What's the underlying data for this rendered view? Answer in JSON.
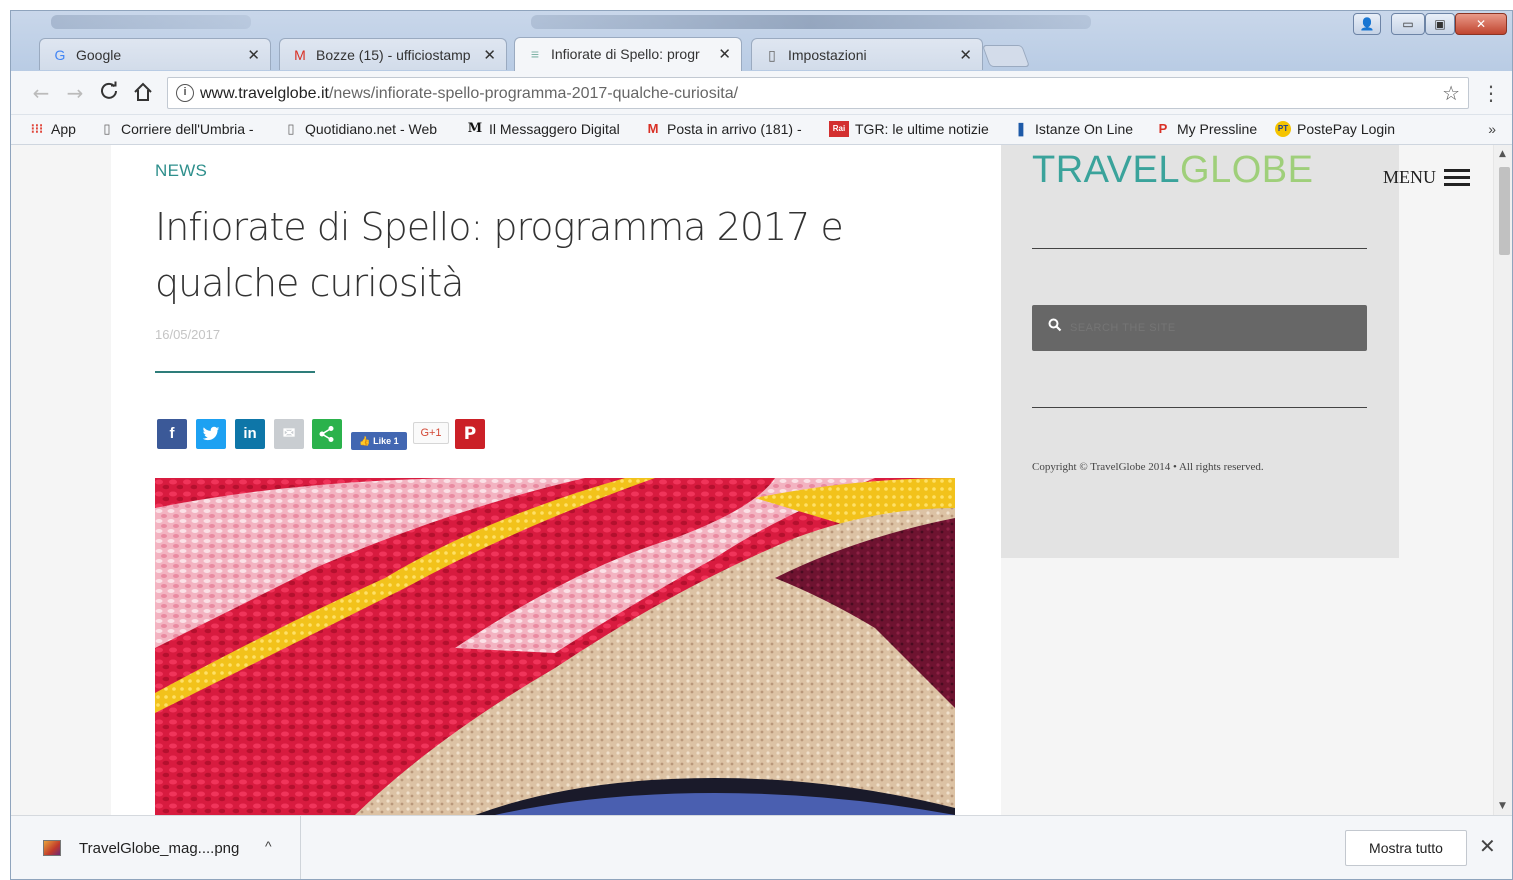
{
  "window": {
    "controls": {
      "user": "👤",
      "minimize": "▭",
      "maximize": "▣",
      "close": "✕"
    }
  },
  "tabs": [
    {
      "label": "Google",
      "icon": "G",
      "icon_name": "google-icon",
      "icon_color": "#4285f4",
      "close": "✕"
    },
    {
      "label": "Bozze (15) - ufficiostamp",
      "icon": "M",
      "icon_name": "gmail-icon",
      "icon_color": "#d93025",
      "close": "✕"
    },
    {
      "label": "Infiorate di Spello: progr",
      "icon": "≡",
      "icon_name": "page-favicon-icon",
      "icon_color": "#7fb3a6",
      "close": "✕",
      "active": true
    },
    {
      "label": "Impostazioni",
      "icon": "▯",
      "icon_name": "document-icon",
      "icon_color": "#666666",
      "close": "✕"
    }
  ],
  "toolbar": {
    "back": "←",
    "forward": "→",
    "reload": "C",
    "home": "⌂",
    "url_host": "www.travelglobe.it",
    "url_path": "/news/infiorate-spello-programma-2017-qualche-curiosita/",
    "info": "i",
    "star": "☆",
    "menu": "⋮"
  },
  "bookmarks": [
    {
      "label": "App",
      "icon": "⁝⁝⁝",
      "icon_name": "apps-grid-icon",
      "icon_color": "#e0453a"
    },
    {
      "label": "Corriere dell'Umbria -",
      "icon": "▯",
      "icon_name": "document-icon",
      "icon_color": "#666666"
    },
    {
      "label": "Quotidiano.net - Web",
      "icon": "▯",
      "icon_name": "document-icon",
      "icon_color": "#666666"
    },
    {
      "label": "Il Messaggero Digital",
      "icon": "M",
      "icon_name": "messaggero-icon",
      "icon_color": "#111111"
    },
    {
      "label": "Posta in arrivo (181) -",
      "icon": "M",
      "icon_name": "gmail-icon",
      "icon_color": "#d93025"
    },
    {
      "label": "TGR: le ultime notizie",
      "icon": "Rai",
      "icon_name": "rai-icon",
      "icon_color": "#d32f2f"
    },
    {
      "label": "Istanze On Line",
      "icon": "❚",
      "icon_name": "istanze-icon",
      "icon_color": "#1e5aa8"
    },
    {
      "label": "My Pressline",
      "icon": "P",
      "icon_name": "pressline-icon",
      "icon_color": "#d93025"
    },
    {
      "label": "PostePay Login",
      "icon": "PT",
      "icon_name": "postepay-icon",
      "icon_color": "#f5c400"
    }
  ],
  "bookmarks_overflow": "»",
  "article": {
    "section": "NEWS",
    "title": "Infiorate di Spello: programma 2017 e qualche curiosità",
    "date": "16/05/2017",
    "share": {
      "facebook": "f",
      "twitter": "t",
      "linkedin": "in",
      "email": "✉",
      "share": "<",
      "like": "👍 Like 1",
      "gplus": "G+1",
      "pinterest": "P"
    }
  },
  "sidebar": {
    "logo_part1": "TRAVEL",
    "logo_part2": "GLOBE",
    "search_icon": "🔍",
    "search_placeholder": "SEARCH THE SITE",
    "copyright": "Copyright © TravelGlobe 2014 • All rights reserved."
  },
  "menu_button": {
    "label": "MENU"
  },
  "scrollbar": {
    "up": "▲",
    "down": "▼"
  },
  "downloads": {
    "filename": "TravelGlobe_mag....png",
    "caret": "^",
    "show_all": "Mostra tutto",
    "close": "✕"
  }
}
